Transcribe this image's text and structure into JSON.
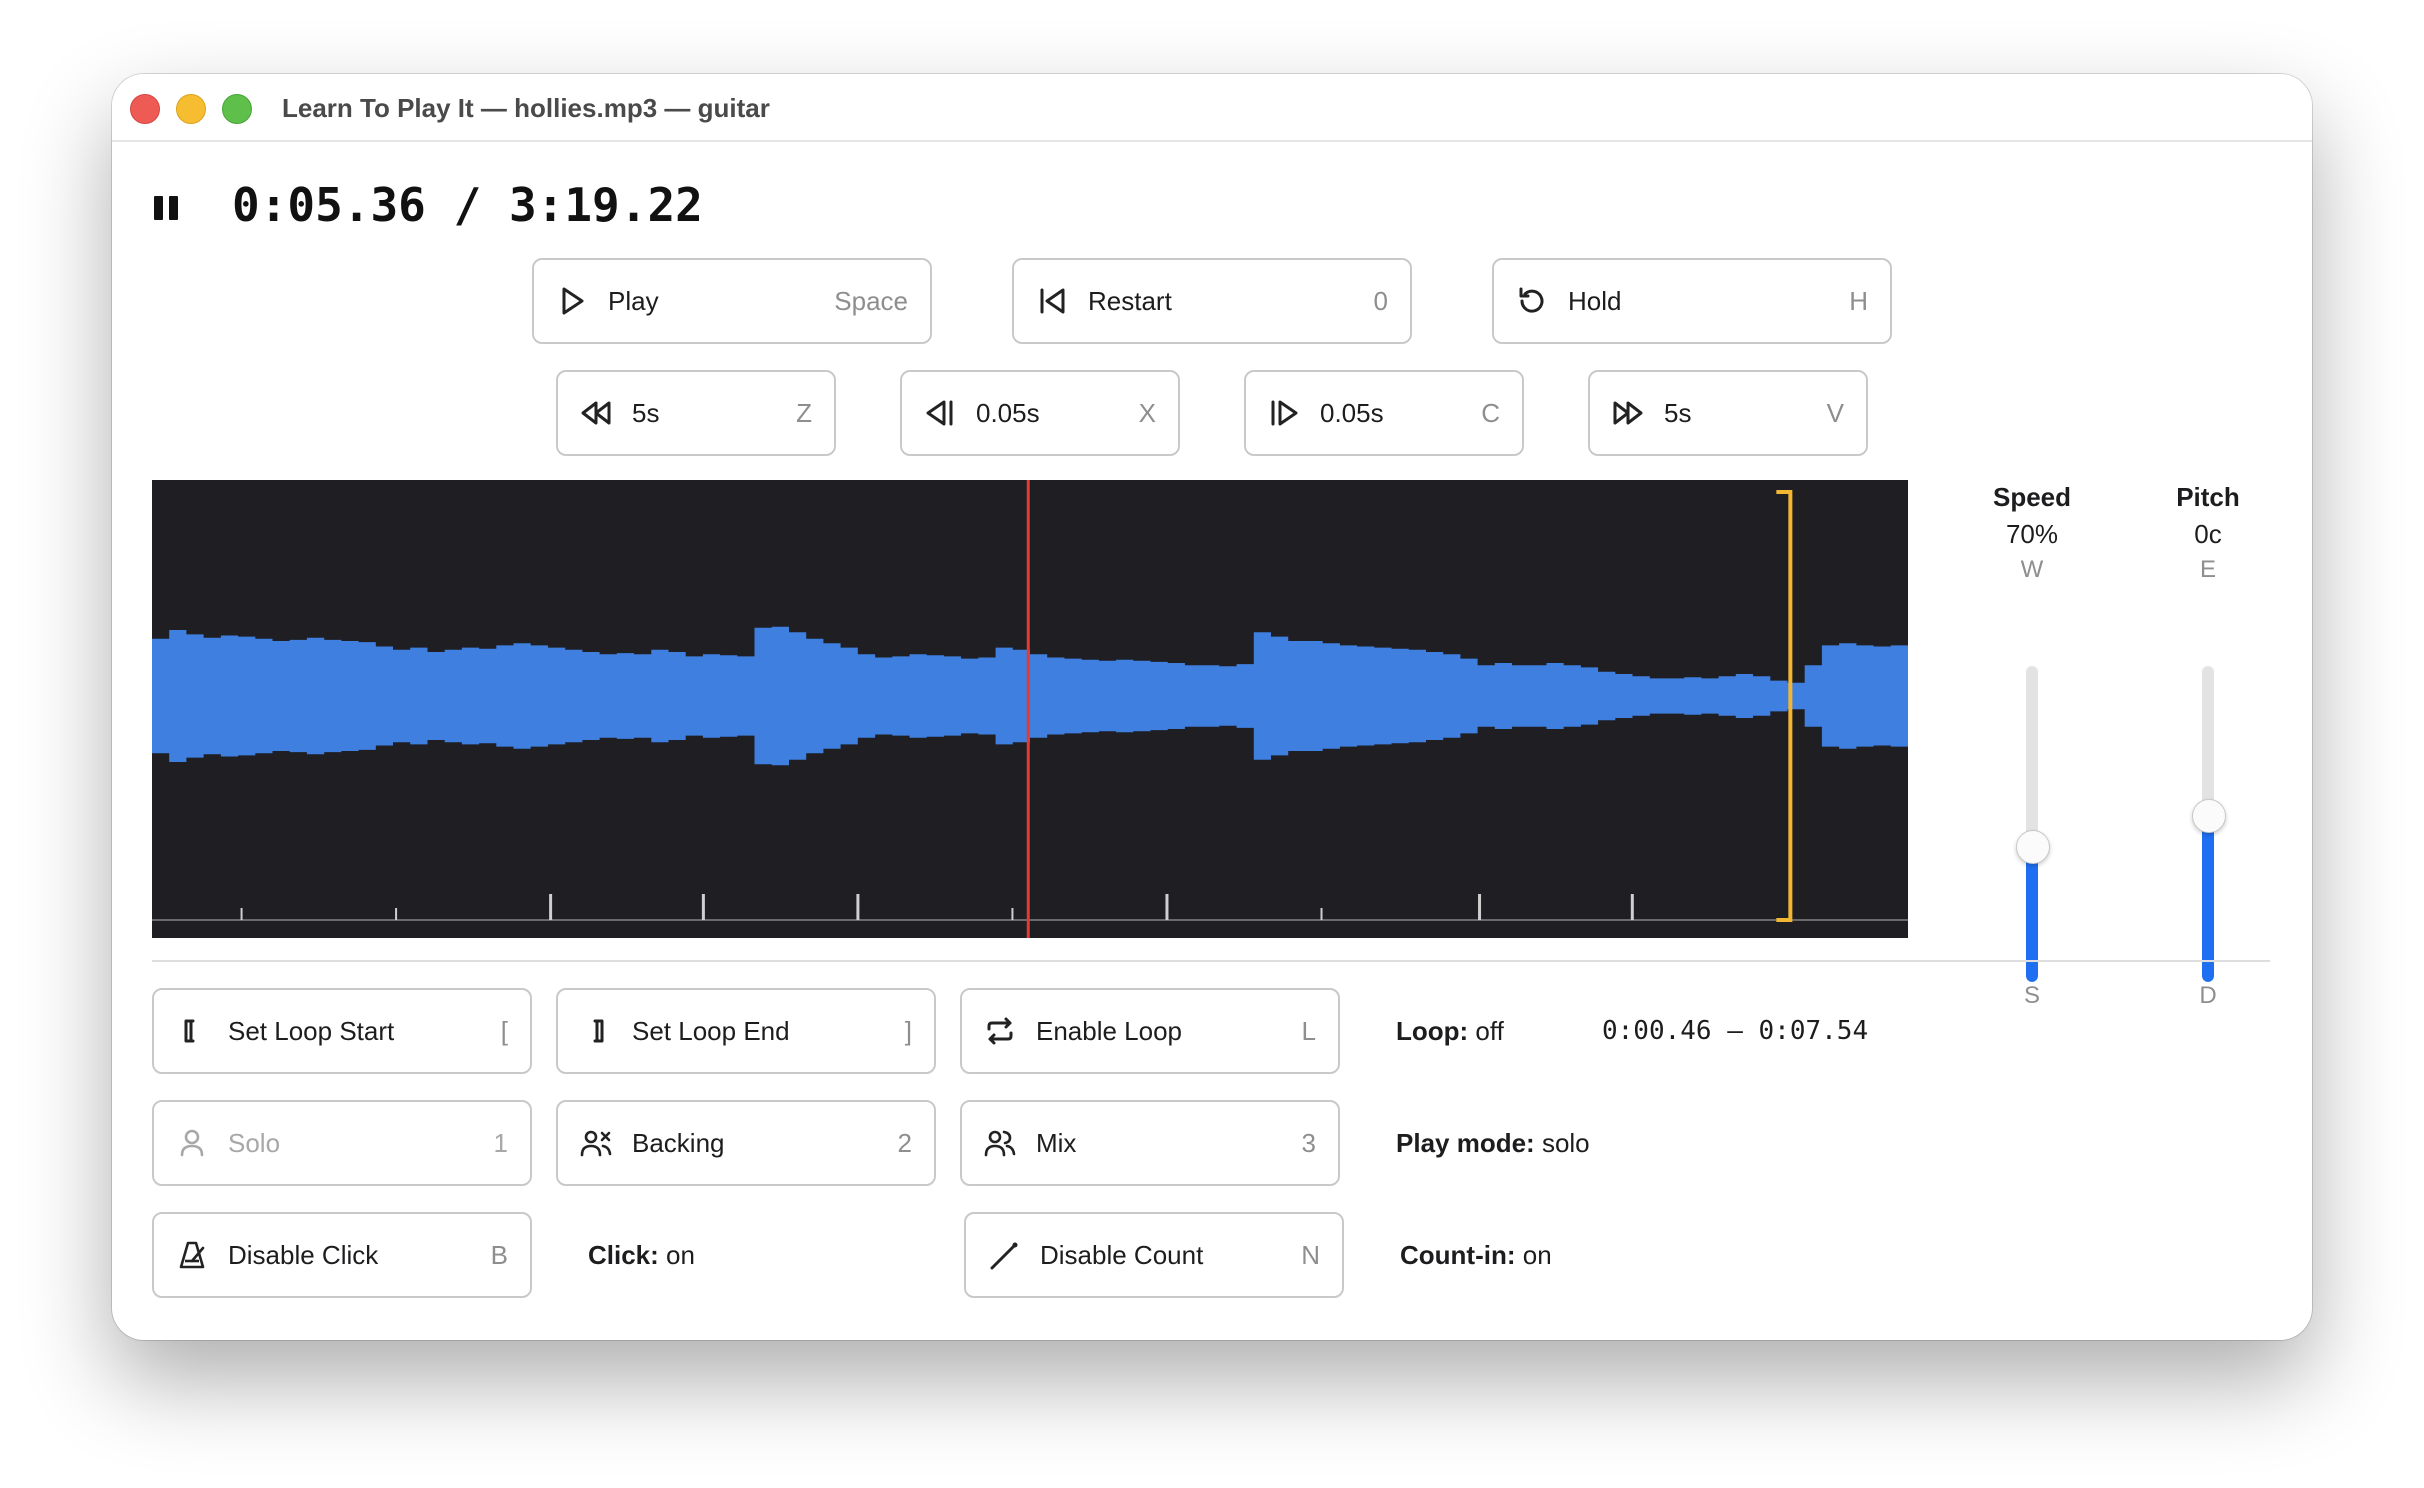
{
  "window": {
    "title": "Learn To Play It — hollies.mp3 — guitar"
  },
  "transport": {
    "current_time": "0:05.36",
    "separator": " / ",
    "total_time": "3:19.22",
    "state_icon": "pause-icon"
  },
  "buttons": {
    "play": {
      "label": "Play",
      "key": "Space",
      "icon": "play-icon"
    },
    "restart": {
      "label": "Restart",
      "key": "0",
      "icon": "skip-to-start-icon"
    },
    "hold": {
      "label": "Hold",
      "key": "H",
      "icon": "rotate-ccw-icon"
    },
    "back_5s": {
      "label": "5s",
      "key": "Z",
      "icon": "rewind-icon"
    },
    "back_005s": {
      "label": "0.05s",
      "key": "X",
      "icon": "step-back-icon"
    },
    "fwd_005s": {
      "label": "0.05s",
      "key": "C",
      "icon": "step-forward-icon"
    },
    "fwd_5s": {
      "label": "5s",
      "key": "V",
      "icon": "fast-forward-icon"
    },
    "set_loop_start": {
      "label": "Set Loop Start",
      "key": "[",
      "icon": "bracket-left-icon"
    },
    "set_loop_end": {
      "label": "Set Loop End",
      "key": "]",
      "icon": "bracket-right-icon"
    },
    "enable_loop": {
      "label": "Enable Loop",
      "key": "L",
      "icon": "repeat-icon"
    },
    "solo": {
      "label": "Solo",
      "key": "1",
      "icon": "user-icon",
      "disabled": true
    },
    "backing": {
      "label": "Backing",
      "key": "2",
      "icon": "users-x-icon"
    },
    "mix": {
      "label": "Mix",
      "key": "3",
      "icon": "users-icon"
    },
    "disable_click": {
      "label": "Disable Click",
      "key": "B",
      "icon": "metronome-icon"
    },
    "disable_count": {
      "label": "Disable Count",
      "key": "N",
      "icon": "drumstick-icon"
    }
  },
  "waveform": {
    "colors": {
      "background": "#1f1f23",
      "wave": "#3f7fdf",
      "playhead": "#e53935",
      "loop_marker": "#f2b632",
      "ticks": "#cfcfcf"
    },
    "playhead_fraction": 0.499,
    "loop_end_fraction": 0.933,
    "amplitudes": [
      0.52,
      0.6,
      0.56,
      0.53,
      0.55,
      0.54,
      0.52,
      0.5,
      0.51,
      0.53,
      0.51,
      0.5,
      0.49,
      0.45,
      0.42,
      0.44,
      0.4,
      0.42,
      0.44,
      0.43,
      0.46,
      0.48,
      0.46,
      0.44,
      0.42,
      0.4,
      0.38,
      0.39,
      0.38,
      0.42,
      0.4,
      0.36,
      0.38,
      0.37,
      0.36,
      0.62,
      0.63,
      0.58,
      0.52,
      0.48,
      0.44,
      0.38,
      0.35,
      0.36,
      0.38,
      0.37,
      0.36,
      0.34,
      0.35,
      0.44,
      0.42,
      0.38,
      0.35,
      0.34,
      0.33,
      0.32,
      0.33,
      0.32,
      0.31,
      0.3,
      0.28,
      0.28,
      0.27,
      0.29,
      0.58,
      0.54,
      0.5,
      0.5,
      0.48,
      0.46,
      0.45,
      0.44,
      0.43,
      0.42,
      0.4,
      0.38,
      0.34,
      0.28,
      0.3,
      0.28,
      0.28,
      0.3,
      0.28,
      0.26,
      0.22,
      0.2,
      0.18,
      0.16,
      0.16,
      0.17,
      0.16,
      0.18,
      0.2,
      0.18,
      0.14,
      0.12,
      0.28,
      0.46,
      0.48,
      0.46,
      0.45,
      0.46
    ],
    "ticks": [
      {
        "fraction": 0.051,
        "major": false
      },
      {
        "fraction": 0.139,
        "major": false
      },
      {
        "fraction": 0.227,
        "major": true
      },
      {
        "fraction": 0.314,
        "major": true
      },
      {
        "fraction": 0.402,
        "major": true
      },
      {
        "fraction": 0.49,
        "major": false
      },
      {
        "fraction": 0.578,
        "major": true
      },
      {
        "fraction": 0.666,
        "major": false
      },
      {
        "fraction": 0.756,
        "major": true
      },
      {
        "fraction": 0.843,
        "major": true
      }
    ]
  },
  "speed": {
    "title": "Speed",
    "value": "70%",
    "key_up": "W",
    "key_down": "S",
    "level": 0.43,
    "color": "#1f6ff3"
  },
  "pitch": {
    "title": "Pitch",
    "value": "0c",
    "key_up": "E",
    "key_down": "D",
    "level": 0.53,
    "color": "#1f6ff3"
  },
  "status": {
    "loop_label": "Loop:",
    "loop_value": " off",
    "loop_range": "0:00.46 – 0:07.54",
    "play_mode_label": "Play mode:",
    "play_mode_value": " solo",
    "click_label": "Click:",
    "click_value": " on",
    "count_label": "Count-in:",
    "count_value": " on"
  }
}
